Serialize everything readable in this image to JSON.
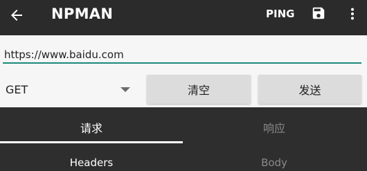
{
  "appbar": {
    "title": "NPMAN",
    "ping_label": "PING",
    "back_icon": "arrow-left-icon",
    "save_icon": "floppy-disk-icon",
    "more_icon": "more-vertical-icon",
    "background": "#2b2b2b"
  },
  "request": {
    "url_value": "https://www.baidu.com",
    "method": "GET",
    "clear_label": "清空",
    "send_label": "发送",
    "accent_color": "#1a8a79"
  },
  "tabs": {
    "primary": [
      {
        "label": "请求",
        "active": true
      },
      {
        "label": "响应",
        "active": false
      }
    ],
    "secondary": [
      {
        "label": "Headers",
        "active": true
      },
      {
        "label": "Body",
        "active": false
      }
    ]
  }
}
